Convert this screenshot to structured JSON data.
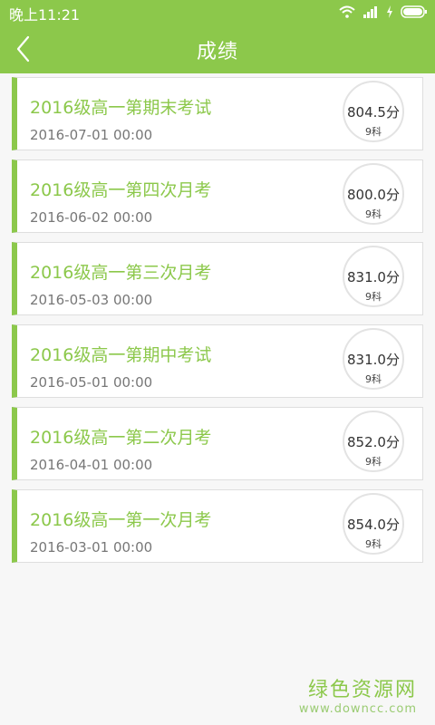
{
  "status_bar": {
    "time": "晚上11:21"
  },
  "header": {
    "title": "成绩"
  },
  "exams": [
    {
      "title": "2016级高一第期末考试",
      "date": "2016-07-01 00:00",
      "score": "804.5分",
      "subjects": "9科"
    },
    {
      "title": "2016级高一第四次月考",
      "date": "2016-06-02 00:00",
      "score": "800.0分",
      "subjects": "9科"
    },
    {
      "title": "2016级高一第三次月考",
      "date": "2016-05-03 00:00",
      "score": "831.0分",
      "subjects": "9科"
    },
    {
      "title": "2016级高一第期中考试",
      "date": "2016-05-01 00:00",
      "score": "831.0分",
      "subjects": "9科"
    },
    {
      "title": "2016级高一第二次月考",
      "date": "2016-04-01 00:00",
      "score": "852.0分",
      "subjects": "9科"
    },
    {
      "title": "2016级高一第一次月考",
      "date": "2016-03-01 00:00",
      "score": "854.0分",
      "subjects": "9科"
    }
  ],
  "watermark": {
    "name": "绿色资源网",
    "url": "www.downcc.com"
  },
  "icons": {
    "back": "back-arrow-icon",
    "wifi": "wifi-icon",
    "signal": "signal-icon",
    "charging": "charging-icon",
    "battery": "battery-icon"
  },
  "colors": {
    "accent": "#8cc84b",
    "background": "#f7f7f7",
    "date_text": "#777777"
  }
}
